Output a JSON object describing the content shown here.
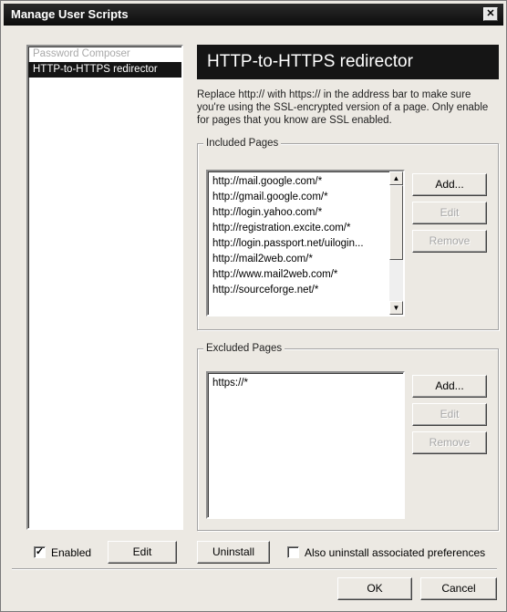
{
  "window": {
    "title": "Manage User Scripts",
    "close_glyph": "✕"
  },
  "scripts": [
    {
      "name": "Password Composer",
      "state": "disabled"
    },
    {
      "name": "HTTP-to-HTTPS redirector",
      "state": "selected"
    }
  ],
  "detail": {
    "title": "HTTP-to-HTTPS redirector",
    "description": "Replace http:// with https:// in the address bar to make sure you're using the SSL-encrypted version of a page. Only enable for pages that you know are SSL enabled."
  },
  "included": {
    "legend": "Included Pages",
    "pages": [
      "http://mail.google.com/*",
      "http://gmail.google.com/*",
      "http://login.yahoo.com/*",
      "http://registration.excite.com/*",
      "http://login.passport.net/uilogin...",
      "http://mail2web.com/*",
      "http://www.mail2web.com/*",
      "http://sourceforge.net/*"
    ],
    "add_label": "Add...",
    "edit_label": "Edit",
    "remove_label": "Remove"
  },
  "excluded": {
    "legend": "Excluded Pages",
    "pages": [
      "https://*"
    ],
    "add_label": "Add...",
    "edit_label": "Edit",
    "remove_label": "Remove"
  },
  "footer": {
    "enabled_label": "Enabled",
    "enabled_checked": true,
    "edit_label": "Edit",
    "uninstall_label": "Uninstall",
    "also_uninstall_label": "Also uninstall associated preferences",
    "also_uninstall_checked": false,
    "ok_label": "OK",
    "cancel_label": "Cancel"
  },
  "colors": {
    "header_bg": "#151515",
    "dialog_bg": "#ece9e3",
    "selection_bg": "#141414"
  }
}
